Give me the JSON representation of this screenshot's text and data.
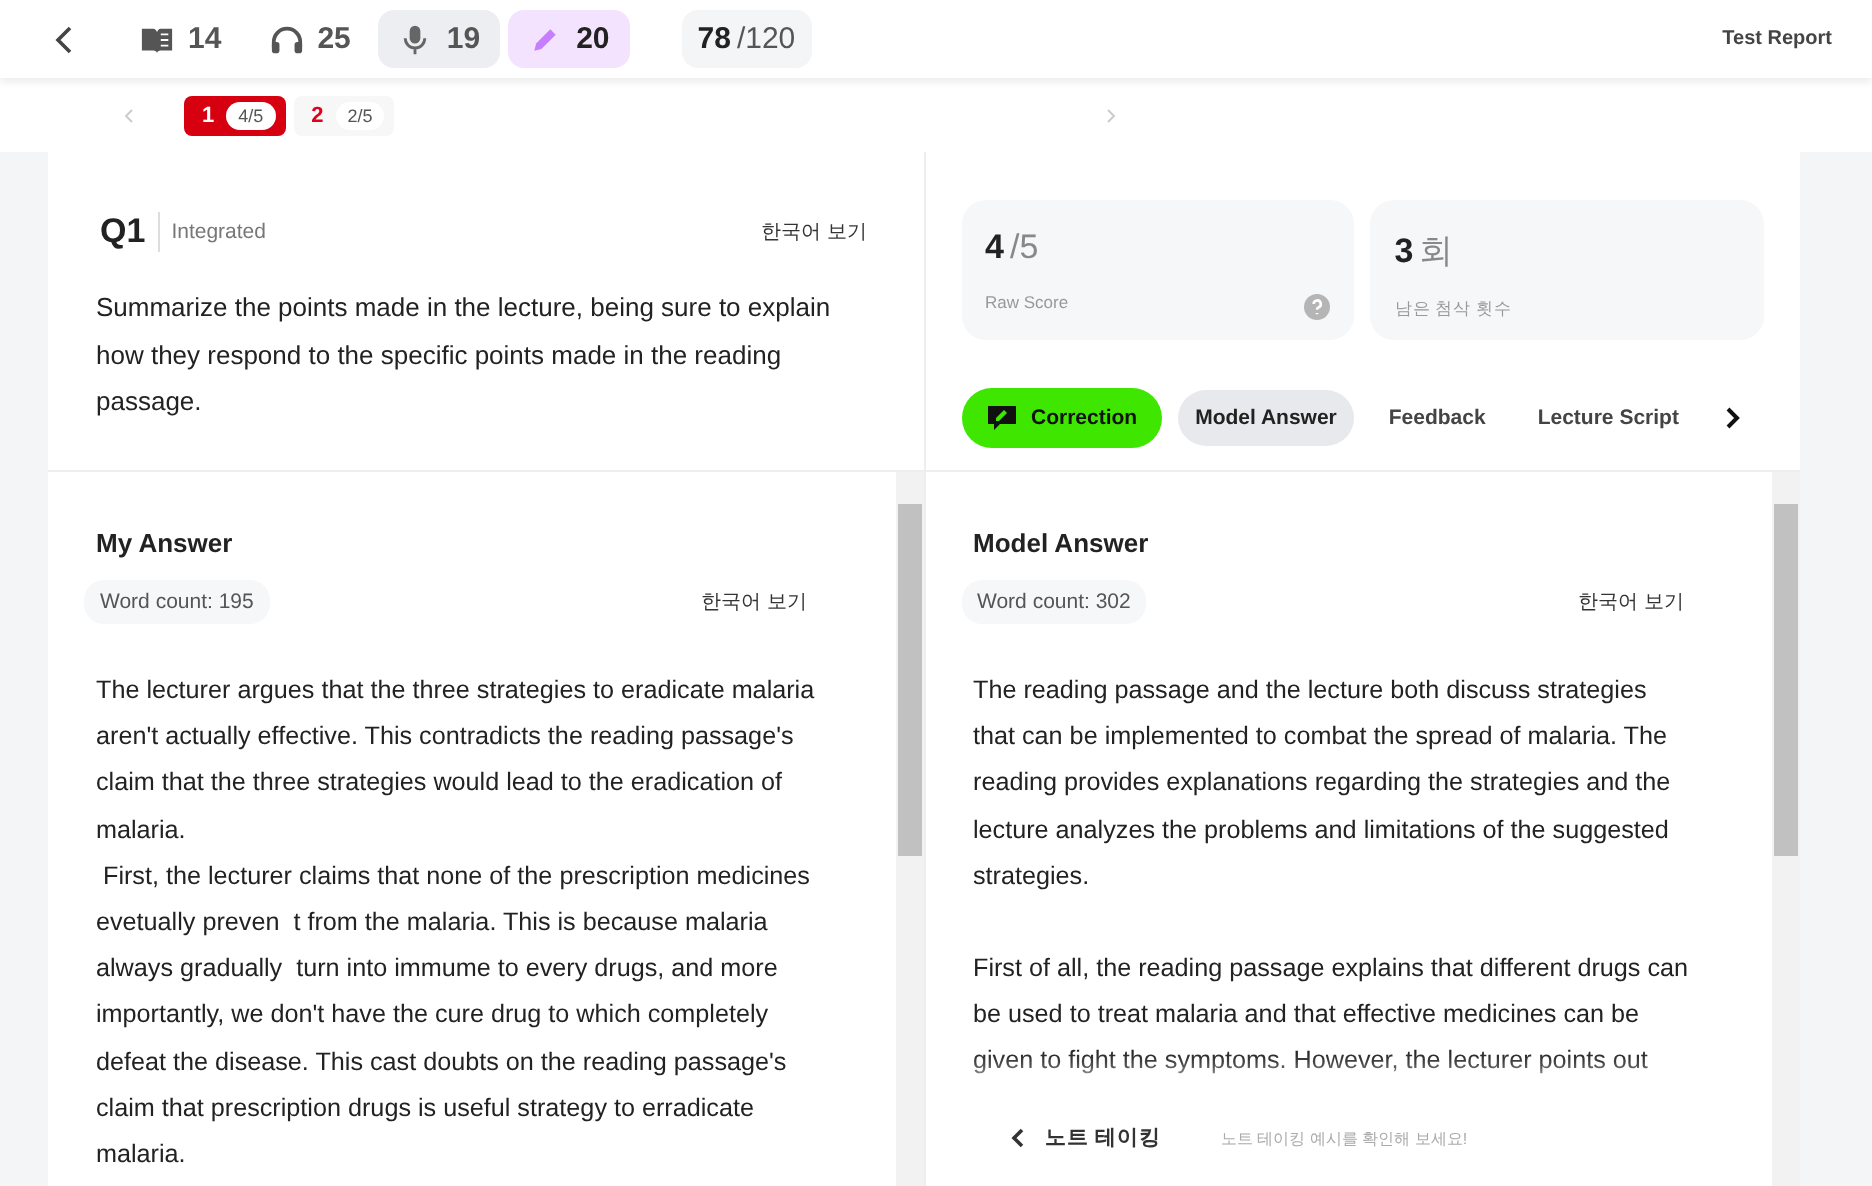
{
  "top_bar": {
    "sections": [
      {
        "kind": "reading",
        "count": "14",
        "selected": false,
        "shaded": false
      },
      {
        "kind": "listening",
        "count": "25",
        "selected": false,
        "shaded": false
      },
      {
        "kind": "speaking",
        "count": "19",
        "selected": false,
        "shaded": true
      },
      {
        "kind": "writing",
        "count": "20",
        "selected": true,
        "shaded": false
      }
    ],
    "total": {
      "score": "78",
      "max": "/120"
    },
    "report_link": "Test Report"
  },
  "pager": {
    "items": [
      {
        "number": "1",
        "score": "4/5",
        "selected": true
      },
      {
        "number": "2",
        "score": "2/5",
        "selected": false
      }
    ]
  },
  "question": {
    "number": "Q1",
    "type": "Integrated",
    "translate": "한국어 보기",
    "prompt": "Summarize the points made in the lecture, being sure to explain how they respond to the specific points made in the reading passage."
  },
  "my_answer": {
    "title": "My Answer",
    "word_count": "Word count: 195",
    "translate": "한국어 보기",
    "paragraphs": [
      "The lecturer argues that the three strategies to eradicate malaria aren't actually effective. This contradicts the reading passage's claim that the three strategies would lead to the eradication of malaria.",
      " First, the lecturer claims that none of the prescription medicines evetually preven  t from the malaria. This is because malaria always gradually  turn into immume to every drugs, and more importantly, we don't have the cure drug to which completely defeat the disease. This cast doubts on the reading passage's claim that prescription drugs is useful strategy to erradicate malaria."
    ]
  },
  "score_cards": [
    {
      "value": "4",
      "unit": "/5",
      "label": "Raw Score",
      "help": true
    },
    {
      "value": "3",
      "unit": "회",
      "label": "남은 첨삭 횟수",
      "help": false
    }
  ],
  "tabs": [
    {
      "label": "Correction",
      "kind": "primary",
      "selected": false
    },
    {
      "label": "Model Answer",
      "kind": "plain",
      "selected": true
    },
    {
      "label": "Feedback",
      "kind": "plain",
      "selected": false
    },
    {
      "label": "Lecture Script",
      "kind": "plain",
      "selected": false
    }
  ],
  "model_answer": {
    "title": "Model Answer",
    "word_count": "Word count: 302",
    "translate": "한국어 보기",
    "paragraphs": [
      "The reading passage and the lecture both discuss strategies that can be implemented to combat the spread of malaria. The reading provides explanations regarding the strategies and the lecture analyzes the problems and limitations of the suggested strategies.",
      "First of all, the reading passage explains that different drugs can be used to treat malaria and that effective medicines can be given to fight the symptoms. However, the lecturer points out"
    ]
  },
  "note_taking": {
    "title": "노트 테이킹",
    "hint": "노트 테이킹 예시를 확인해 보세요!"
  }
}
